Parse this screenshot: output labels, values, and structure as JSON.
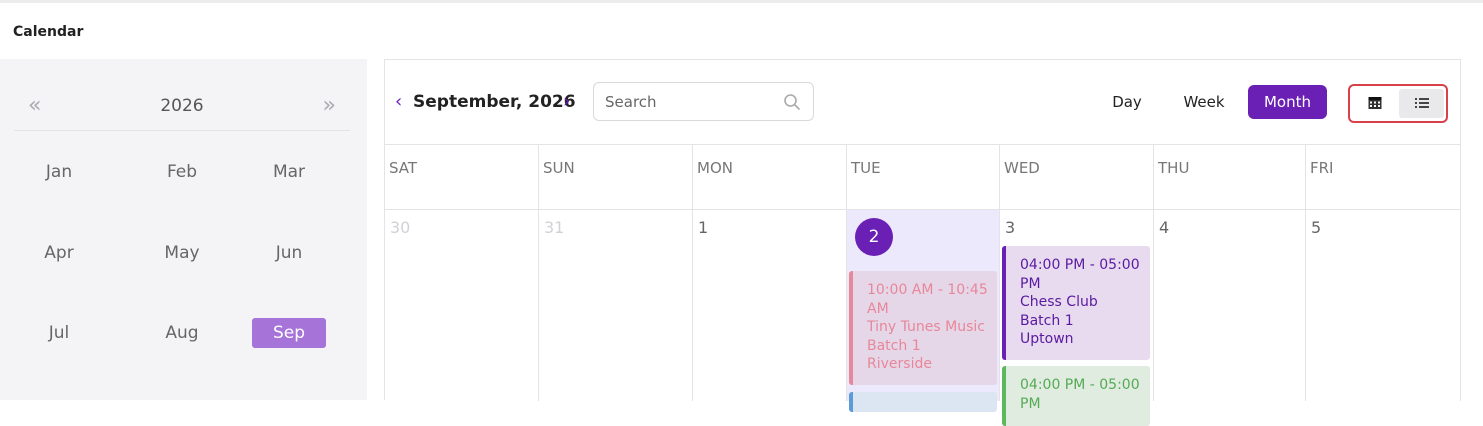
{
  "page": {
    "title": "Calendar"
  },
  "mini_calendar": {
    "year": "2026",
    "prev_symbol": "«",
    "next_symbol": "»",
    "months": [
      "Jan",
      "Feb",
      "Mar",
      "Apr",
      "May",
      "Jun",
      "Jul",
      "Aug",
      "Sep"
    ],
    "selected_month": "Sep"
  },
  "header": {
    "prev_symbol": "‹",
    "next_symbol": "›",
    "title": "September, 2026",
    "search_placeholder": "Search",
    "views": {
      "day": "Day",
      "week": "Week",
      "month": "Month"
    },
    "active_view": "Month",
    "toggle_icons": {
      "grid": "calendar-grid-icon",
      "list": "list-icon"
    }
  },
  "week_days": [
    "SAT",
    "SUN",
    "MON",
    "TUE",
    "WED",
    "THU",
    "FRI"
  ],
  "days": [
    {
      "num": "30",
      "muted": true
    },
    {
      "num": "31",
      "muted": true
    },
    {
      "num": "1",
      "muted": false
    },
    {
      "num": "2",
      "muted": false,
      "today": true
    },
    {
      "num": "3",
      "muted": false
    },
    {
      "num": "4",
      "muted": false
    },
    {
      "num": "5",
      "muted": false
    }
  ],
  "events": {
    "tue_1": {
      "time": "10:00 AM - 10:45 AM",
      "title": "Tiny Tunes Music",
      "batch": "Batch 1",
      "location": "Riverside"
    },
    "wed_1": {
      "time": "04:00 PM - 05:00 PM",
      "title": "Chess Club",
      "batch": "Batch 1",
      "location": "Uptown"
    },
    "wed_2": {
      "time": "04:00 PM - 05:00 PM"
    }
  },
  "colors": {
    "accent": "#6a1fb5",
    "selected_month_bg": "#a673d9",
    "highlight_border": "#d8404b",
    "today_bg": "#ebe9fb"
  }
}
